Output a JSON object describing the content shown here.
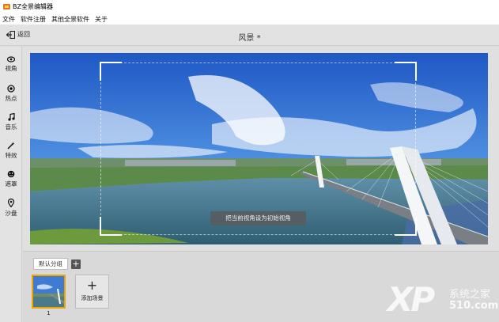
{
  "window": {
    "title": "BZ全景编辑器"
  },
  "menu": [
    "文件",
    "软件注册",
    "其他全景软件",
    "关于"
  ],
  "header": {
    "back_label": "返回",
    "scene_title": "风景 *"
  },
  "sidebar": {
    "items": [
      {
        "label": "视角",
        "icon": "eye-icon"
      },
      {
        "label": "热点",
        "icon": "hotspot-icon"
      },
      {
        "label": "音乐",
        "icon": "music-icon"
      },
      {
        "label": "特效",
        "icon": "wand-icon"
      },
      {
        "label": "遮罩",
        "icon": "mask-icon"
      },
      {
        "label": "沙盘",
        "icon": "map-pin-icon"
      }
    ]
  },
  "viewer": {
    "set_initial_label": "把当前视角设为初始视角"
  },
  "scenes": {
    "group_tab": "默认分组",
    "add_group": "+",
    "items": [
      {
        "number": "1"
      }
    ],
    "add_scene_plus": "+",
    "add_scene_label": "添加场景"
  },
  "watermark": {
    "xp": "XP",
    "cn": "系统之家",
    "num": "510.com"
  },
  "colors": {
    "accent_thumb_border": "#f0a400",
    "sky": "#2a66cc"
  }
}
